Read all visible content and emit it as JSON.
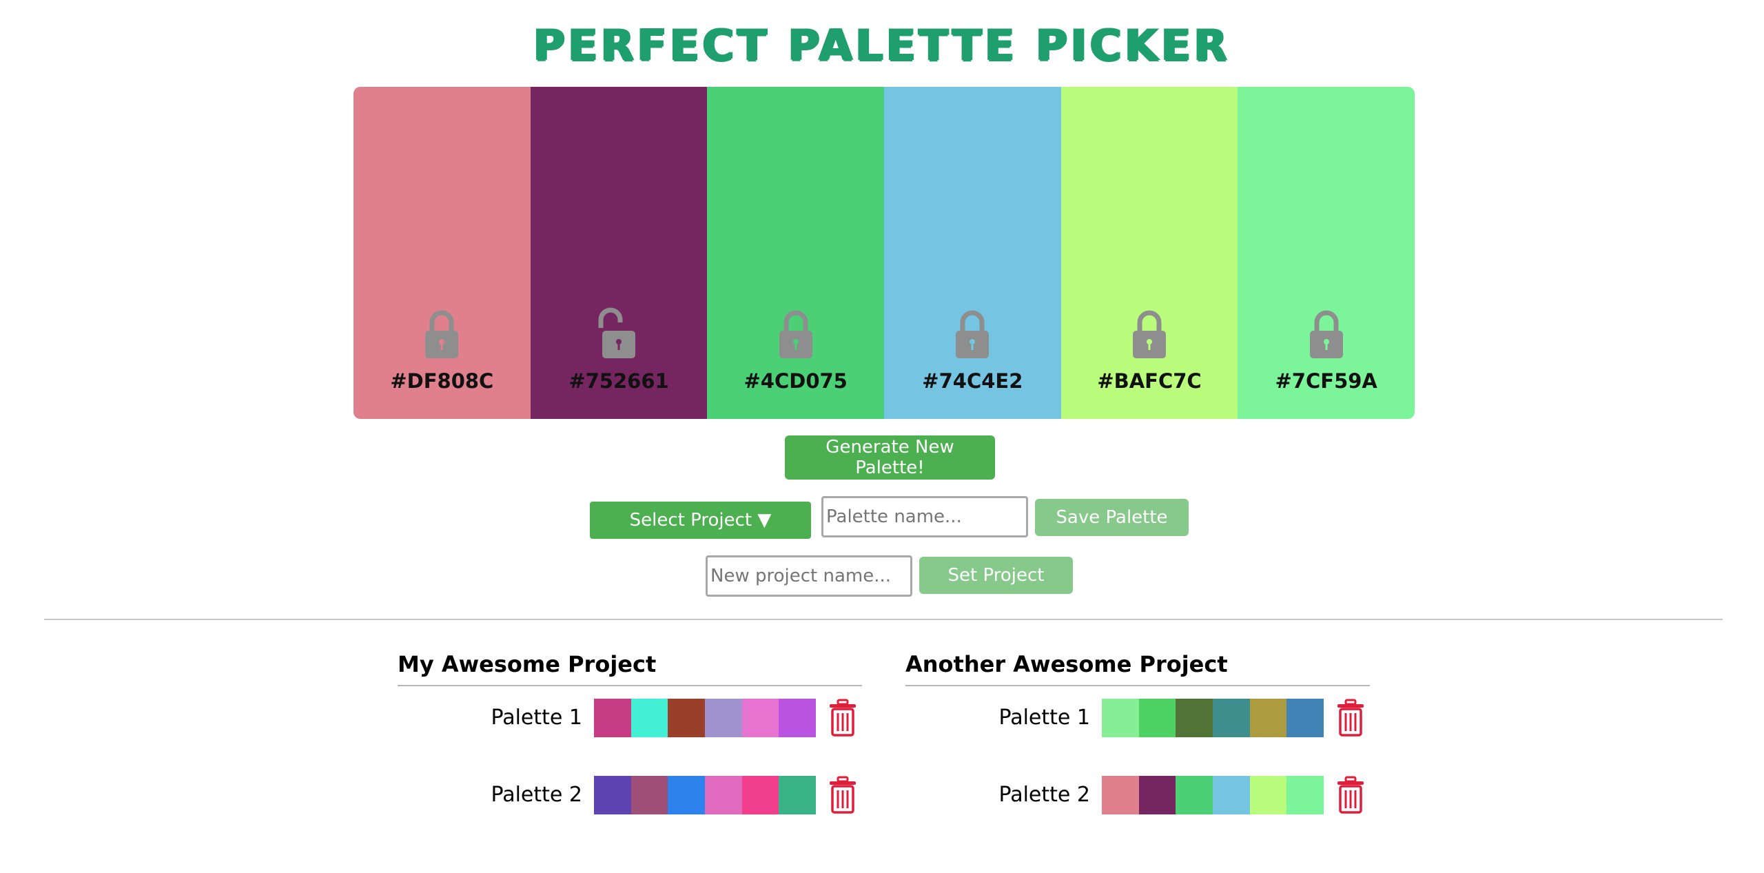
{
  "title": "PERFECT PALETTE PICKER",
  "colors": [
    {
      "hex": "#DF808C",
      "locked": true,
      "icon": "lock-icon"
    },
    {
      "hex": "#752661",
      "locked": false,
      "icon": "unlock-icon"
    },
    {
      "hex": "#4CD075",
      "locked": true,
      "icon": "lock-icon"
    },
    {
      "hex": "#74C4E2",
      "locked": true,
      "icon": "lock-icon"
    },
    {
      "hex": "#BAFC7C",
      "locked": true,
      "icon": "lock-icon"
    },
    {
      "hex": "#7CF59A",
      "locked": true,
      "icon": "lock-icon"
    }
  ],
  "controls": {
    "generate_label": "Generate New Palette!",
    "select_project_label": "Select Project ▼",
    "palette_name_placeholder": "Palette name...",
    "save_palette_label": "Save Palette",
    "new_project_placeholder": "New project name...",
    "set_project_label": "Set Project"
  },
  "projects": [
    {
      "name": "My Awesome Project",
      "palettes": [
        {
          "name": "Palette 1",
          "colors": [
            "#C63D85",
            "#43F0D6",
            "#9A3F2A",
            "#A091CF",
            "#E673D0",
            "#BB53E1"
          ]
        },
        {
          "name": "Palette 2",
          "colors": [
            "#5E44B0",
            "#9D4F77",
            "#2D82EB",
            "#E06BBF",
            "#F23F8D",
            "#39B288"
          ]
        }
      ]
    },
    {
      "name": "Another Awesome Project",
      "palettes": [
        {
          "name": "Palette 1",
          "colors": [
            "#86EE95",
            "#4ED263",
            "#517436",
            "#3F8E8E",
            "#AD9B3F",
            "#4183B5"
          ]
        },
        {
          "name": "Palette 2",
          "colors": [
            "#DF808C",
            "#752661",
            "#4CD075",
            "#74C4E2",
            "#BAFC7C",
            "#7CF59A"
          ]
        }
      ]
    }
  ],
  "accent": "#4CAF50",
  "title_color": "#1F9E6E",
  "delete_color": "#E01E3C"
}
